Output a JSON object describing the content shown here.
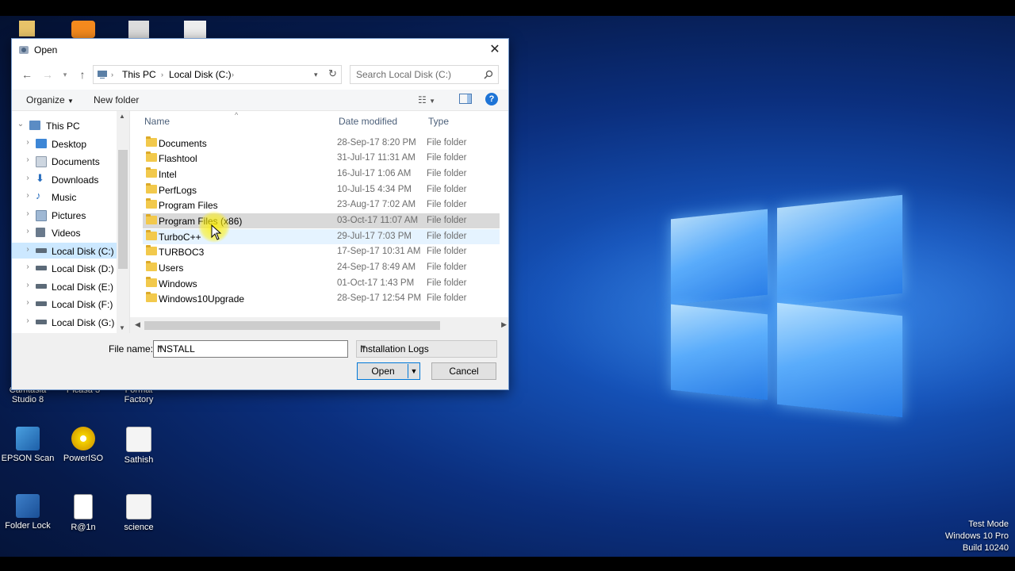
{
  "desktop": {
    "icons_partial": [
      {
        "label": "Camtasia\nStudio 8"
      },
      {
        "label": "Picasa 3"
      },
      {
        "label": "Format\nFactory"
      }
    ],
    "icons": [
      {
        "label": "EPSON Scan",
        "icon": "scanner-icon"
      },
      {
        "label": "PowerISO",
        "icon": "disc-icon"
      },
      {
        "label": "Sathish",
        "icon": "document-icon"
      },
      {
        "label": "Folder Lock",
        "icon": "lock-icon"
      },
      {
        "label": "R@1n",
        "icon": "text-file-icon"
      },
      {
        "label": "science",
        "icon": "document-icon"
      }
    ],
    "watermark": [
      "Test Mode",
      "Windows 10 Pro",
      "Build 10240"
    ]
  },
  "dialog": {
    "title": "Open",
    "breadcrumb": [
      "This PC",
      "Local Disk (C:)"
    ],
    "search_placeholder": "Search Local Disk (C:)",
    "toolbar": {
      "organize": "Organize",
      "new_folder": "New folder"
    },
    "nav_items": [
      {
        "label": "This PC",
        "icon": "computer-icon",
        "expanded": true,
        "selected": false
      },
      {
        "label": "Desktop",
        "icon": "desktop-folder-icon",
        "selected": false
      },
      {
        "label": "Documents",
        "icon": "documents-folder-icon",
        "selected": false
      },
      {
        "label": "Downloads",
        "icon": "downloads-folder-icon",
        "selected": false
      },
      {
        "label": "Music",
        "icon": "music-folder-icon",
        "selected": false
      },
      {
        "label": "Pictures",
        "icon": "pictures-folder-icon",
        "selected": false
      },
      {
        "label": "Videos",
        "icon": "videos-folder-icon",
        "selected": false
      },
      {
        "label": "Local Disk (C:)",
        "icon": "drive-icon",
        "selected": true
      },
      {
        "label": "Local Disk (D:)",
        "icon": "drive-icon",
        "selected": false
      },
      {
        "label": "Local Disk (E:)",
        "icon": "drive-icon",
        "selected": false
      },
      {
        "label": "Local Disk (F:)",
        "icon": "drive-icon",
        "selected": false
      },
      {
        "label": "Local Disk (G:)",
        "icon": "drive-icon",
        "selected": false
      }
    ],
    "columns": {
      "name": "Name",
      "date": "Date modified",
      "type": "Type"
    },
    "files": [
      {
        "name": "Documents",
        "date": "28-Sep-17 8:20 PM",
        "type": "File folder"
      },
      {
        "name": "Flashtool",
        "date": "31-Jul-17 11:31 AM",
        "type": "File folder"
      },
      {
        "name": "Intel",
        "date": "16-Jul-17 1:06 AM",
        "type": "File folder"
      },
      {
        "name": "PerfLogs",
        "date": "10-Jul-15 4:34 PM",
        "type": "File folder"
      },
      {
        "name": "Program Files",
        "date": "23-Aug-17 7:02 AM",
        "type": "File folder"
      },
      {
        "name": "Program Files (x86)",
        "date": "03-Oct-17 11:07 AM",
        "type": "File folder",
        "state": "selected"
      },
      {
        "name": "TurboC++",
        "date": "29-Jul-17 7:03 PM",
        "type": "File folder",
        "state": "hover"
      },
      {
        "name": "TURBOC3",
        "date": "17-Sep-17 10:31 AM",
        "type": "File folder"
      },
      {
        "name": "Users",
        "date": "24-Sep-17 8:49 AM",
        "type": "File folder"
      },
      {
        "name": "Windows",
        "date": "01-Oct-17 1:43 PM",
        "type": "File folder"
      },
      {
        "name": "Windows10Upgrade",
        "date": "28-Sep-17 12:54 PM",
        "type": "File folder"
      }
    ],
    "file_name_label": "File name:",
    "file_name_value": "INSTALL",
    "file_type": "Installation Logs",
    "open_label": "Open",
    "cancel_label": "Cancel"
  },
  "colors": {
    "accent": "#0078d7",
    "selection": "#cce8ff",
    "folder": "#f2c94c"
  }
}
